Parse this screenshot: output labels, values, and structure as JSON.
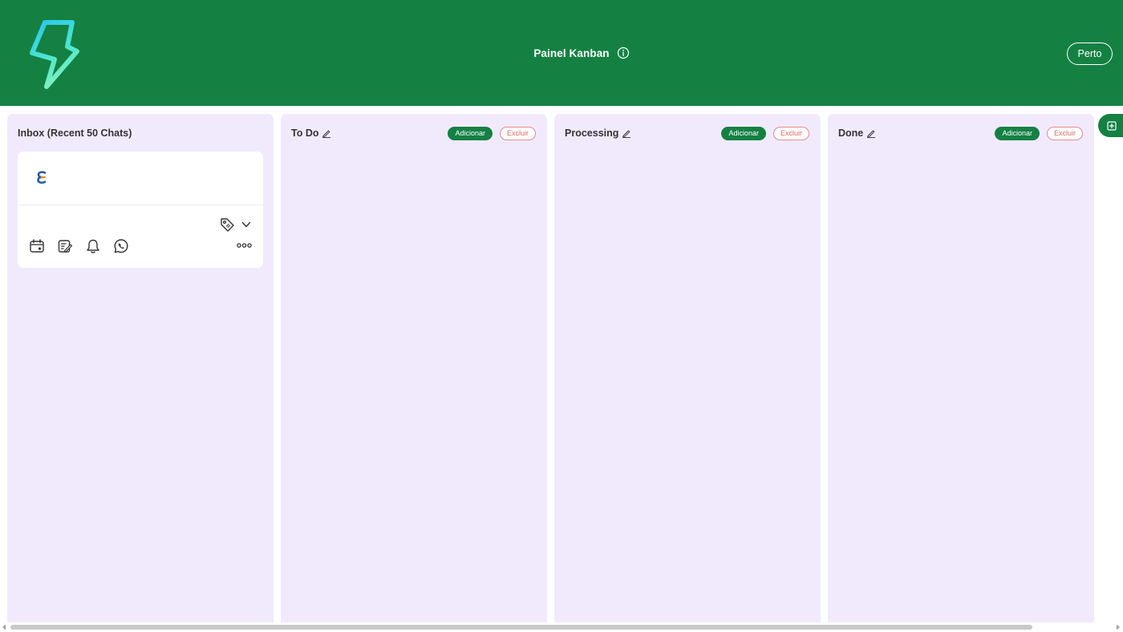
{
  "header": {
    "title": "Painel Kanban",
    "close_label": "Perto",
    "background_color": "#148143",
    "logo_icon": "lightning-bolt-icon"
  },
  "inbox": {
    "title": "Inbox (Recent 50 Chats)",
    "card": {
      "avatar_icon": "e-logo-icon",
      "tools": [
        "calendar-icon",
        "note-edit-icon",
        "bell-icon",
        "whatsapp-icon"
      ],
      "tag_icon": "tag-icon",
      "more_icon": "more-options-icon"
    }
  },
  "columns": [
    {
      "title": "To Do",
      "add_label": "Adicionar",
      "delete_label": "Excluir"
    },
    {
      "title": "Processing",
      "add_label": "Adicionar",
      "delete_label": "Excluir"
    },
    {
      "title": "Done",
      "add_label": "Adicionar",
      "delete_label": "Excluir"
    }
  ],
  "colors": {
    "accent": "#148143",
    "column_bg": "#f1eafd",
    "delete_red": "#e06a6a"
  }
}
